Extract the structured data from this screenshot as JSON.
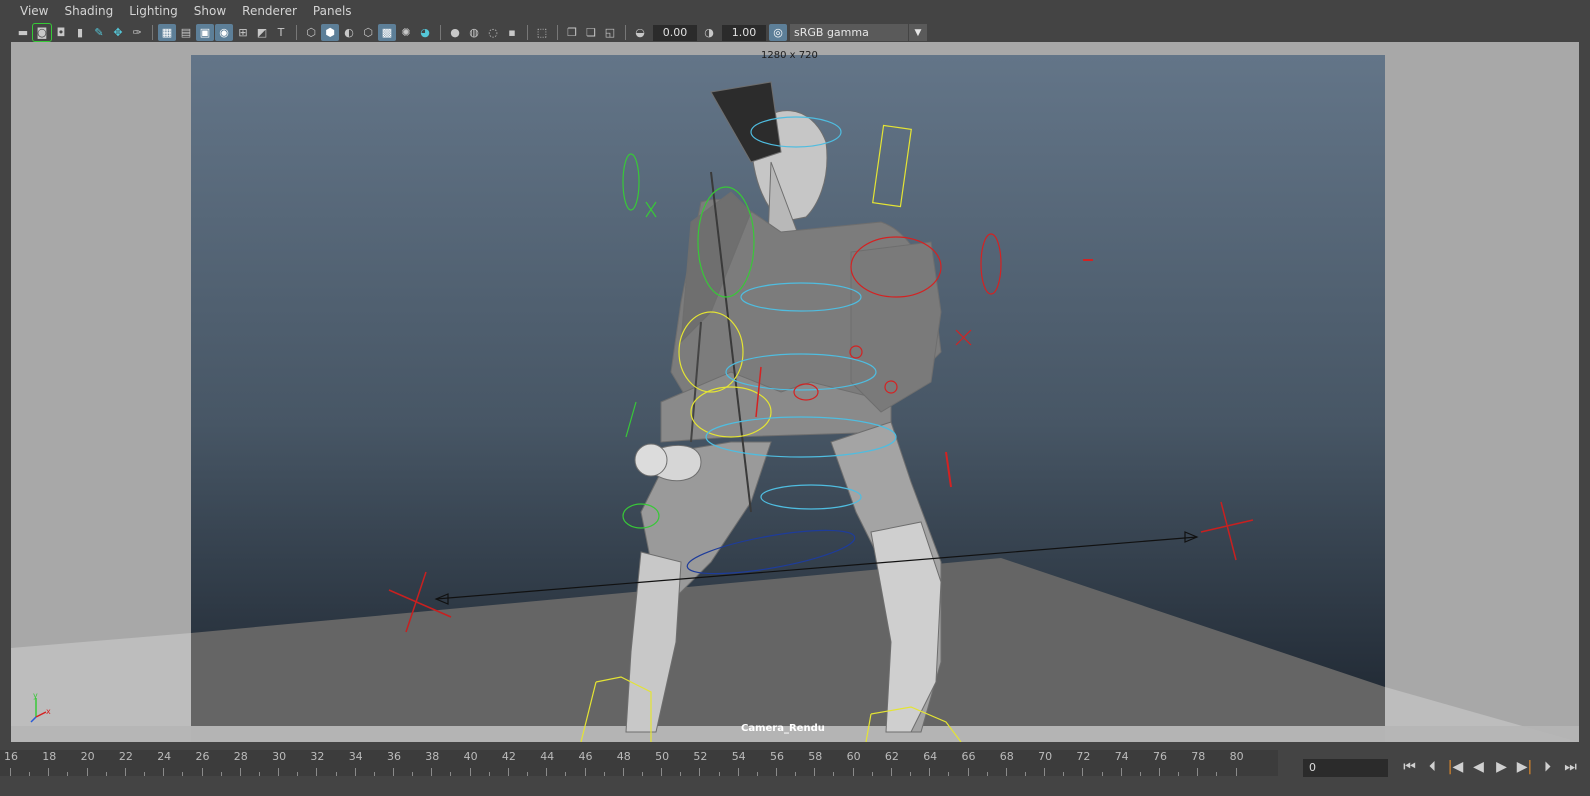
{
  "menu": [
    "View",
    "Shading",
    "Lighting",
    "Show",
    "Renderer",
    "Panels"
  ],
  "toolbar": {
    "exposure_value": "0.00",
    "gamma_value": "1.00",
    "colorspace": "sRGB gamma",
    "icons": [
      "camera-select-icon",
      "camera-attributes-icon",
      "film-gate-icon",
      "bookmark-icon",
      "grease-pencil-icon",
      "image-plane-icon",
      "paint-icon",
      "grid-icon",
      "film-gate-toggle-icon",
      "resolution-gate-icon",
      "gate-mask-icon",
      "field-chart-icon",
      "safe-action-icon",
      "safe-title-icon",
      "wireframe-icon",
      "smooth-shade-icon",
      "default-material-icon",
      "textured-icon",
      "xray-icon",
      "use-lights-icon",
      "shadows-icon",
      "screen-space-ao-icon",
      "motion-blur-icon",
      "multisample-aa-icon",
      "depth-of-field-icon",
      "isolate-select-icon",
      "xray-active-icon",
      "xray-joints-icon",
      "backface-icon",
      "exposure-icon",
      "gamma-icon",
      "color-management-icon"
    ]
  },
  "viewport": {
    "resolution_label": "1280 x 720",
    "camera_label": "Camera_Rendu"
  },
  "timeline": {
    "tick_labels": [
      "16",
      "18",
      "20",
      "22",
      "24",
      "26",
      "28",
      "30",
      "32",
      "34",
      "36",
      "38",
      "40",
      "42",
      "44",
      "46",
      "48",
      "50",
      "52",
      "54",
      "56",
      "58",
      "60",
      "62",
      "64",
      "66",
      "68",
      "70",
      "72",
      "74",
      "76",
      "78",
      "80"
    ],
    "current_frame": "0"
  },
  "playback_icons": [
    "go-to-start-icon",
    "step-back-key-icon",
    "step-back-frame-icon",
    "play-backward-icon",
    "play-forward-icon",
    "step-forward-key-icon",
    "step-forward-frame-icon",
    "go-to-end-icon"
  ],
  "colors": {
    "control_green": "#38c838",
    "control_yellow": "#e4e434",
    "control_red": "#d42222",
    "control_cyan": "#4fbde0",
    "control_blue": "#1e3c9a"
  }
}
